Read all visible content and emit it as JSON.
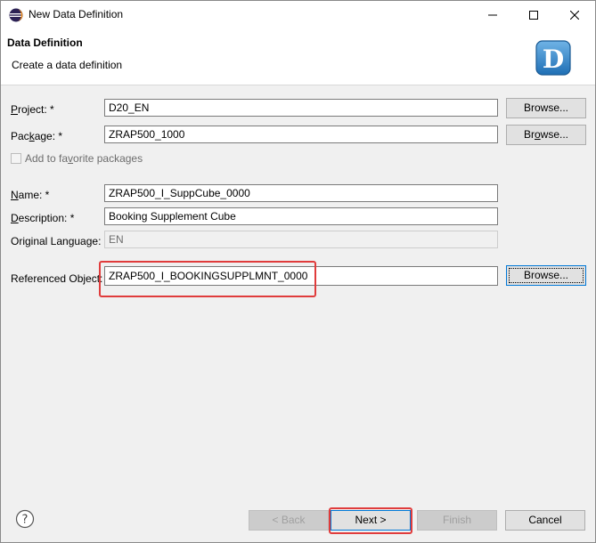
{
  "window": {
    "title": "New Data Definition",
    "controls": {
      "minimize": "minimize",
      "maximize": "maximize",
      "close": "close"
    }
  },
  "header": {
    "title": "Data Definition",
    "description": "Create a data definition",
    "logo_letter": "D"
  },
  "form": {
    "project": {
      "label_mn": "P",
      "label_rest": "roject: *",
      "value": "D20_EN",
      "browse": "Browse..."
    },
    "package": {
      "label_pre": "Pac",
      "label_mn": "k",
      "label_rest": "age: *",
      "value": "ZRAP500_1000",
      "browse_pre": "Br",
      "browse_mn": "o",
      "browse_rest": "wse..."
    },
    "favorite": {
      "label_pre": "Add to fa",
      "label_mn": "v",
      "label_rest": "orite packages",
      "checked": false
    },
    "name": {
      "label_mn": "N",
      "label_rest": "ame: *",
      "value": "ZRAP500_I_SuppCube_0000"
    },
    "description": {
      "label_mn": "D",
      "label_rest": "escription: *",
      "value": "Booking Supplement Cube"
    },
    "original_language": {
      "label": "Original Language:",
      "value": "EN"
    },
    "referenced_object": {
      "label": "Referenced Object:",
      "value": "ZRAP500_I_BOOKINGSUPPLMNT_0000",
      "browse": "Browse..."
    }
  },
  "footer": {
    "back": "< Back",
    "next": "Next >",
    "finish": "Finish",
    "cancel": "Cancel"
  },
  "colors": {
    "highlight": "#e03c3c",
    "focus": "#0078d7"
  }
}
